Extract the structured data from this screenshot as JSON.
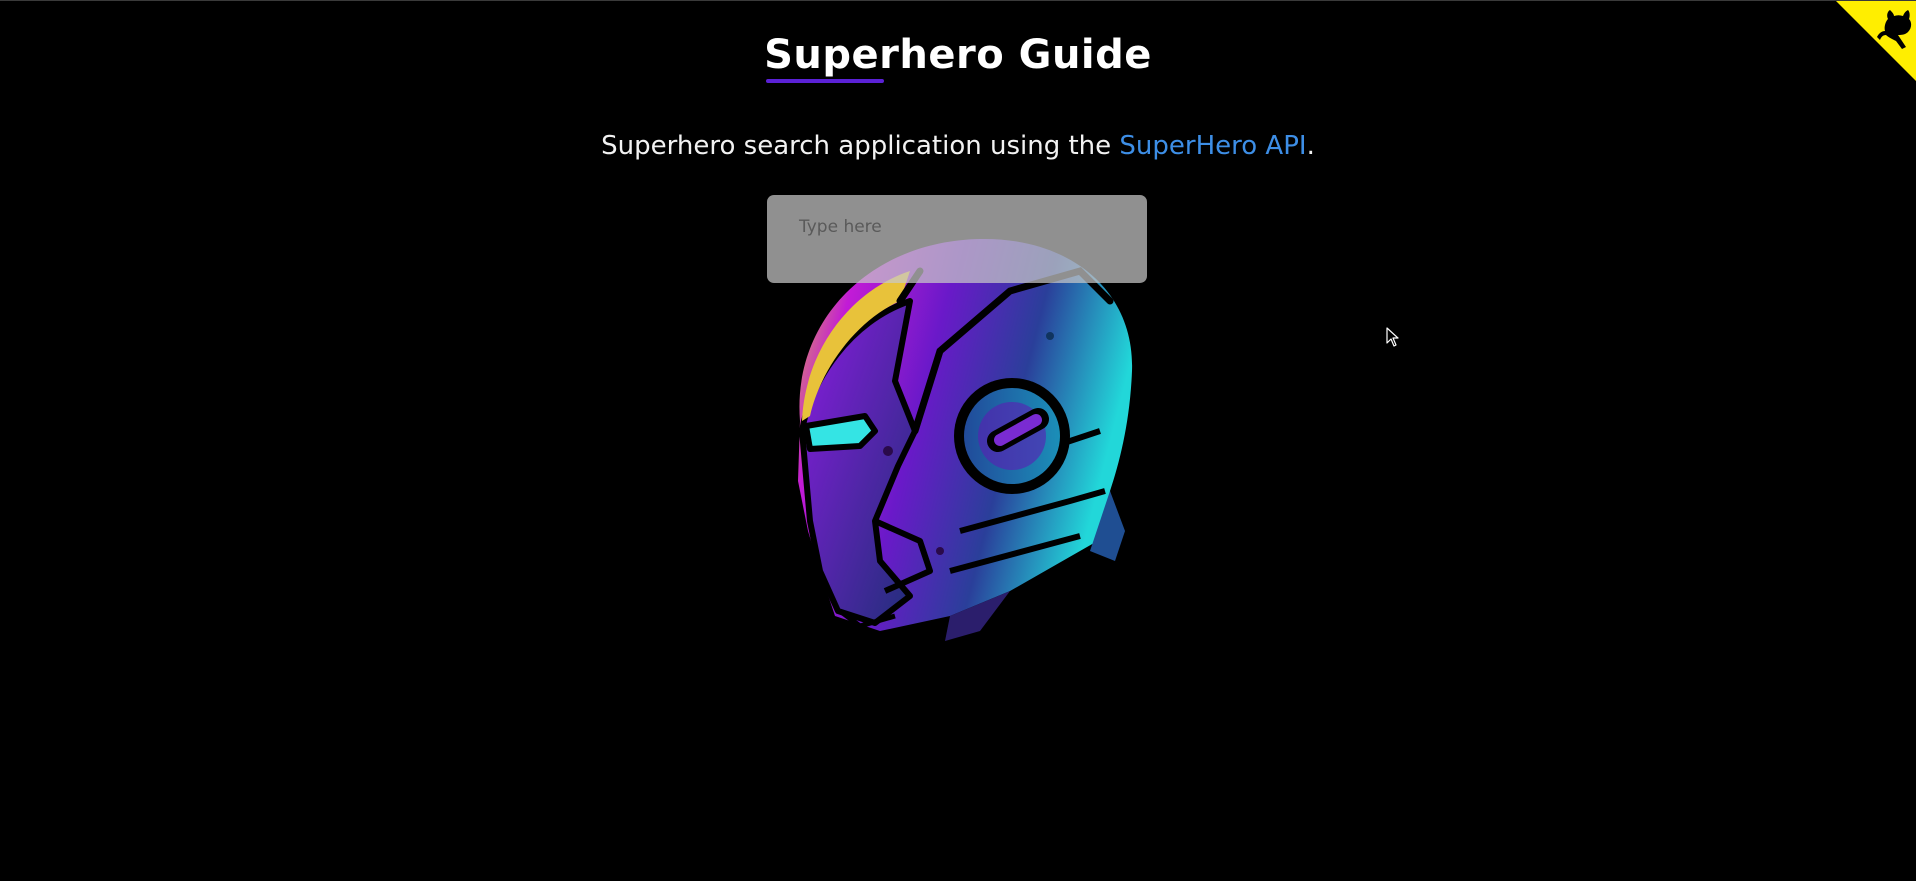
{
  "header": {
    "title": "Superhero Guide"
  },
  "intro": {
    "text_before": "Superhero search application using the ",
    "link_text": "SuperHero API",
    "text_after": "."
  },
  "search": {
    "placeholder": "Type here",
    "value": ""
  },
  "colors": {
    "background": "#000000",
    "accent": "#5b21d6",
    "link": "#3d8ee6",
    "corner": "#ffee00"
  },
  "icons": {
    "corner": "github-cat-icon",
    "hero_image": "robot-helmet-illustration"
  }
}
